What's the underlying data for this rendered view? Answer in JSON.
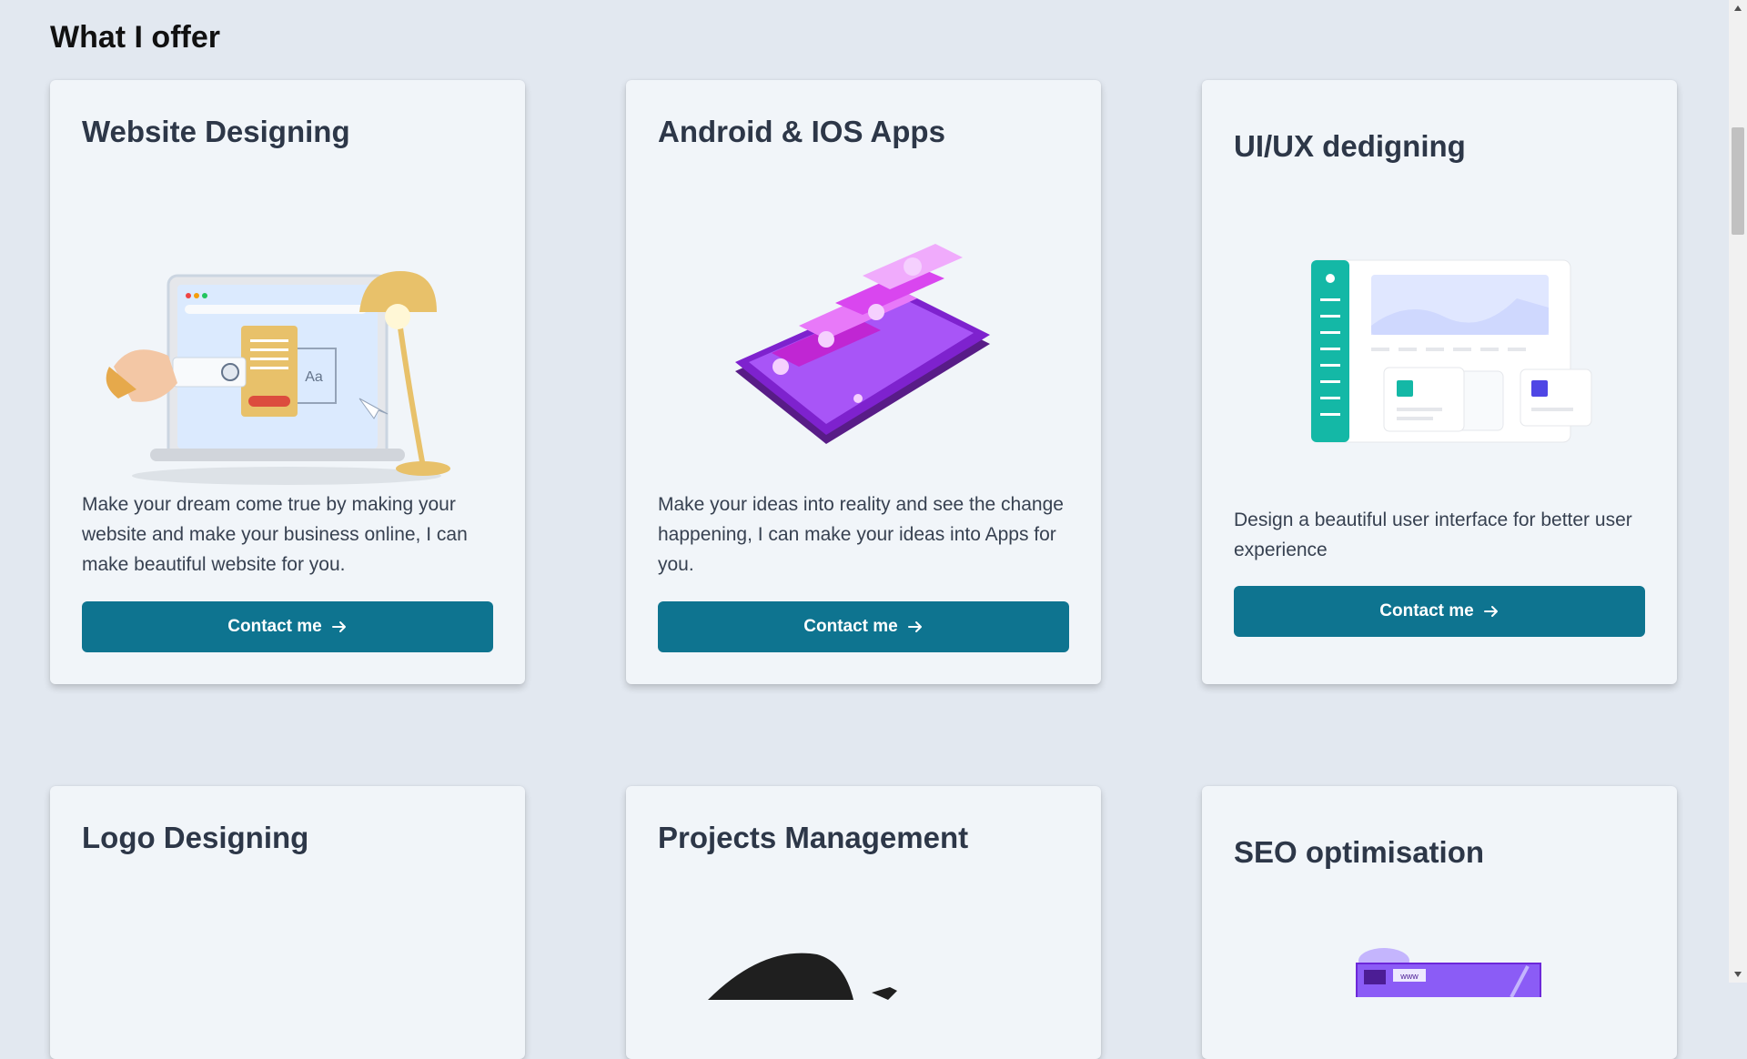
{
  "section": {
    "title": "What I offer"
  },
  "cards": [
    {
      "title": "Website Designing",
      "description": "Make your dream come true by making your website and make your business online, I can make beautiful website for you.",
      "button": "Contact me",
      "illustration": "laptop-with-lamp-illustration"
    },
    {
      "title": "Android & IOS Apps",
      "description": "Make your ideas into reality and see the change happening, I can make your ideas into Apps for you.",
      "button": "Contact me",
      "illustration": "smartphone-chat-bubbles-illustration"
    },
    {
      "title": "UI/UX dedigning",
      "description": "Design a beautiful user interface for better user experience",
      "button": "Contact me",
      "illustration": "dashboard-mockup-illustration"
    },
    {
      "title": "Logo Designing"
    },
    {
      "title": "Projects Management",
      "illustration": "dark-blob-illustration"
    },
    {
      "title": "SEO optimisation",
      "illustration": "purple-browser-window-illustration",
      "badge": "www"
    }
  ],
  "colors": {
    "background": "#e2e8f0",
    "card": "#f1f5f9",
    "button": "#0e7490",
    "heading": "#2d3748"
  },
  "icons": {
    "button_arrow": "arrow-right-icon",
    "scroll_up": "triangle-up-icon",
    "scroll_down": "triangle-down-icon"
  }
}
